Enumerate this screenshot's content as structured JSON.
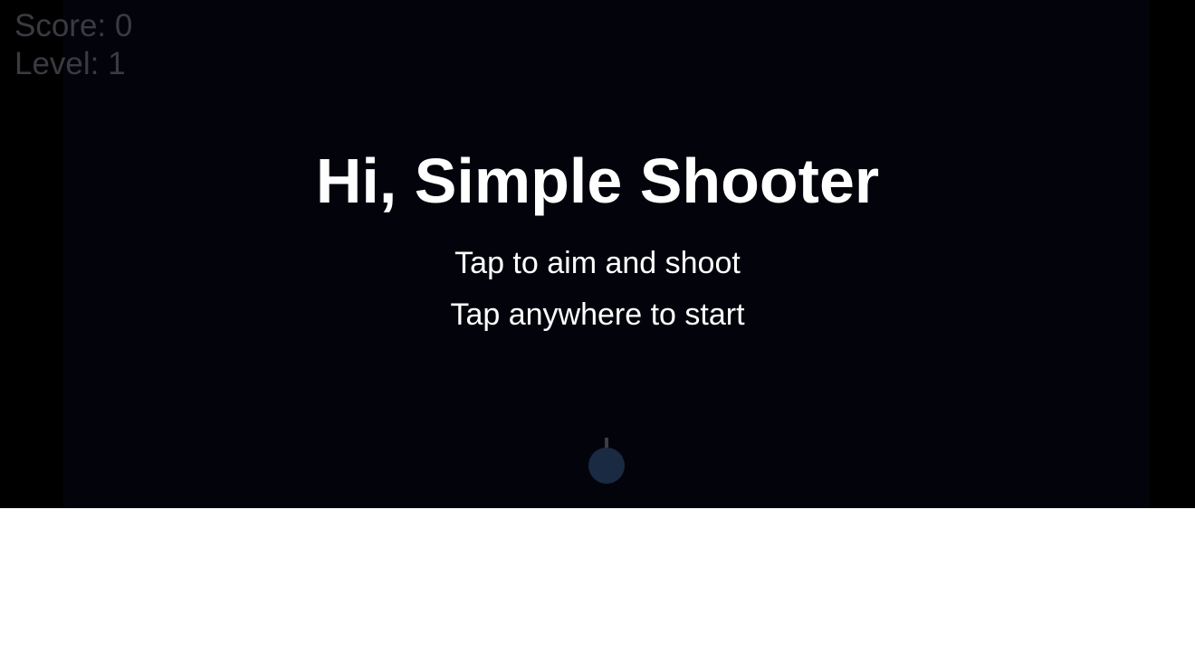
{
  "hud": {
    "score_text": "Score: 0",
    "level_text": "Level: 1",
    "color": "#3a3b42"
  },
  "start_screen": {
    "title": "Hi, Simple Shooter",
    "instruction": "Tap to aim and shoot",
    "prompt": "Tap anywhere to start"
  },
  "colors": {
    "frame": "#000000",
    "playfield": "#03040b",
    "text": "#ffffff",
    "player": "#1a2a42",
    "barrel": "#3a3d45"
  },
  "player": {
    "icon": "cannon-turret-icon"
  }
}
